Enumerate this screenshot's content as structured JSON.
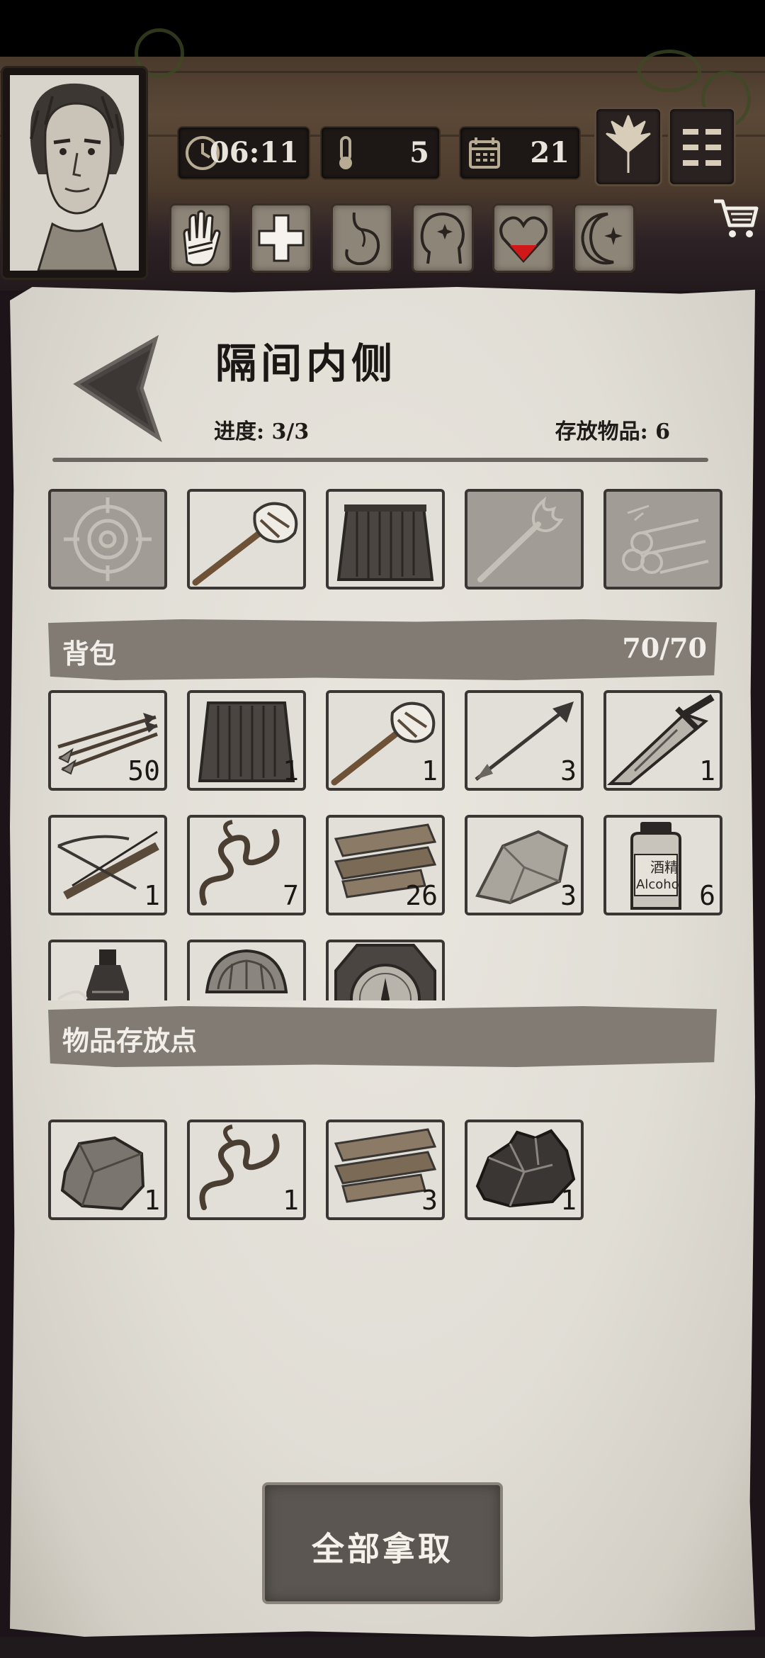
{
  "hud": {
    "time": "06:11",
    "temperature": "5",
    "day": "21"
  },
  "container": {
    "title": "隔间内侧",
    "progress": "进度: 3/3",
    "stored": "存放物品: 6"
  },
  "backpack": {
    "label": "背包",
    "capacity": "70/70",
    "items": [
      {
        "name": "arrows",
        "count": "50"
      },
      {
        "name": "grass-skirt",
        "count": "1"
      },
      {
        "name": "stone-hammer",
        "count": "1"
      },
      {
        "name": "spear-arrow",
        "count": "3"
      },
      {
        "name": "broad-sword",
        "count": "1"
      },
      {
        "name": "crossbow",
        "count": "1"
      },
      {
        "name": "vine-rope",
        "count": "7"
      },
      {
        "name": "wood-planks",
        "count": "26"
      },
      {
        "name": "stone",
        "count": "3"
      },
      {
        "name": "alcohol-bottle",
        "count": "6",
        "label_cn": "酒精",
        "label_en": "Alcoho"
      },
      {
        "name": "potion-bottle",
        "count": ""
      },
      {
        "name": "pearl-shell",
        "count": ""
      },
      {
        "name": "compass",
        "count": ""
      }
    ]
  },
  "storage": {
    "label": "物品存放点",
    "items": [
      {
        "name": "rock",
        "count": "1"
      },
      {
        "name": "vine-rope",
        "count": "1"
      },
      {
        "name": "wood-planks",
        "count": "3"
      },
      {
        "name": "ore-chunk",
        "count": "1"
      }
    ]
  },
  "actions": {
    "take_all": "全部拿取"
  }
}
